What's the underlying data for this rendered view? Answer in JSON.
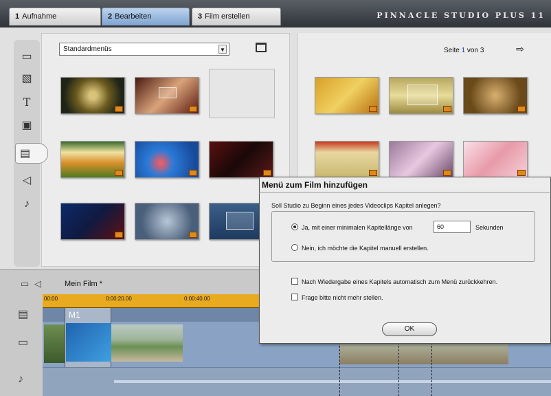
{
  "tabs": [
    {
      "num": "1",
      "label": "Aufnahme"
    },
    {
      "num": "2",
      "label": "Bearbeiten"
    },
    {
      "num": "3",
      "label": "Film erstellen"
    }
  ],
  "brand": "PINNACLE STUDIO PLUS 11",
  "album": {
    "menu_select": "Standardmenüs",
    "page_prefix": "Seite ",
    "page_current": "1",
    "page_suffix": " von 3"
  },
  "timeline": {
    "film_title": "Mein Film *",
    "ruler_ticks": [
      "00:00",
      "0:00:20.00",
      "0:00:40.00"
    ],
    "marker": "M1"
  },
  "dialog": {
    "title": "Menü zum Film hinzufügen",
    "question": "Soll Studio zu Beginn eines jedes Videoclips Kapitel anlegen?",
    "option_yes": "Ja, mit einer minimalen Kapitellänge von",
    "length_value": "60",
    "length_unit": "Sekunden",
    "option_no": "Nein, ich möchte die Kapitel manuell erstellen.",
    "check_return": "Nach Wiedergabe eines Kapitels automatisch zum Menü zurückkehren.",
    "check_noask": "Frage bitte nicht mehr stellen.",
    "ok_label": "OK"
  },
  "colors": {
    "active_tab": "#7ea3d0",
    "ruler": "#e8aa1e",
    "track": "#8aa3c4",
    "page_number": "#1a3fb8"
  },
  "icons": {
    "left_toolbar": [
      "video-clip-icon",
      "transition-icon",
      "title-icon",
      "photo-icon",
      "disc-menu-icon",
      "sound-effects-icon",
      "music-icon"
    ]
  }
}
